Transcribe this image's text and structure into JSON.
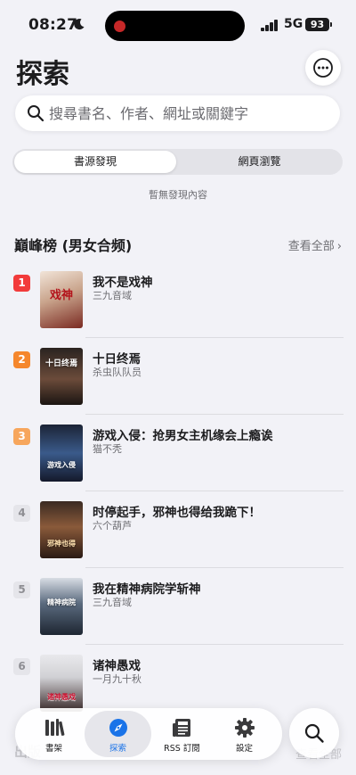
{
  "status": {
    "time": "08:27",
    "network": "5G",
    "battery": "93"
  },
  "header": {
    "title": "探索"
  },
  "search": {
    "placeholder": "搜尋書名、作者、網址或關鍵字"
  },
  "segments": [
    {
      "label": "書源發現",
      "active": true
    },
    {
      "label": "網頁瀏覽",
      "active": false
    }
  ],
  "empty_note": "暫無發現內容",
  "section": {
    "title": "巔峰榜 (男女合频)",
    "view_all": "查看全部"
  },
  "books": [
    {
      "rank": "1",
      "title": "我不是戏神",
      "author": "三九音域",
      "cover_text": "戏神"
    },
    {
      "rank": "2",
      "title": "十日终焉",
      "author": "杀虫队队员",
      "cover_text": "十日终焉"
    },
    {
      "rank": "3",
      "title": "游戏入侵：抢男女主机缘会上瘾诶",
      "author": "猫不秃",
      "cover_text": "游戏入侵"
    },
    {
      "rank": "4",
      "title": "时停起手，邪神也得给我跪下！",
      "author": "六个葫芦",
      "cover_text": "邪神也得"
    },
    {
      "rank": "5",
      "title": "我在精神病院学斩神",
      "author": "三九音域",
      "cover_text": "精神病院"
    },
    {
      "rank": "6",
      "title": "诸神愚戏",
      "author": "一月九十秋",
      "cover_text": "诸神愚戏"
    }
  ],
  "next_section": {
    "title": "出版",
    "view_all": "查看全部"
  },
  "tabbar": [
    {
      "label": "書架",
      "icon": "bookshelf-icon",
      "active": false
    },
    {
      "label": "探索",
      "icon": "compass-icon",
      "active": true
    },
    {
      "label": "RSS 訂閱",
      "icon": "newspaper-icon",
      "active": false
    },
    {
      "label": "設定",
      "icon": "gear-icon",
      "active": false
    }
  ],
  "colors": {
    "accent": "#1a73e8",
    "rank1": "#f23b3b",
    "rank2": "#f5872c",
    "rank3": "#f7a65c",
    "rank_other_bg": "#e5e5ea",
    "rank_other_text": "#8e8e93"
  }
}
